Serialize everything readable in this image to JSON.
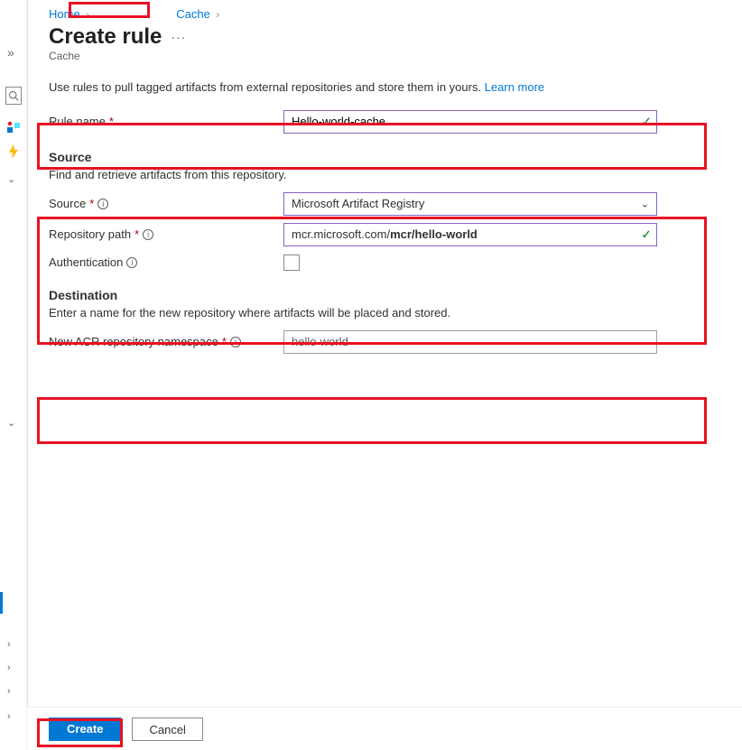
{
  "breadcrumb": {
    "home": "Home",
    "cache": "Cache"
  },
  "header": {
    "title": "Create rule",
    "subtitle": "Cache",
    "more": "···"
  },
  "help": {
    "text": "Use rules to pull tagged artifacts from external repositories and store them in yours. ",
    "link": "Learn more"
  },
  "form": {
    "rule_name_label": "Rule name",
    "rule_name_value": "Hello-world-cache",
    "source_heading": "Source",
    "source_sub": "Find and retrieve artifacts from this repository.",
    "source_label": "Source",
    "source_value": "Microsoft Artifact Registry",
    "repo_label": "Repository path",
    "repo_prefix": "mcr.microsoft.com/",
    "repo_bold": "mcr/hello-world",
    "auth_label": "Authentication",
    "dest_heading": "Destination",
    "dest_sub": "Enter a name for the new repository where artifacts will be placed and stored.",
    "ns_label": "New ACR repository namespace",
    "ns_value": "hello-world"
  },
  "footer": {
    "create": "Create",
    "cancel": "Cancel"
  },
  "icons": {
    "info": "i",
    "check": "✓"
  },
  "rail": {
    "collapse": "»",
    "chev": "⌄",
    "right": "›"
  }
}
